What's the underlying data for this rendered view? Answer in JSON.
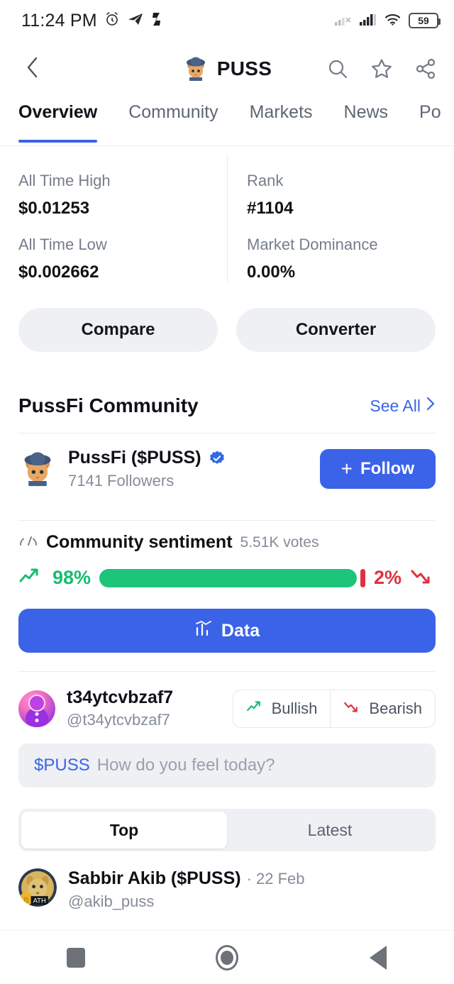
{
  "statusbar": {
    "time": "11:24 PM",
    "battery": "59",
    "icons": [
      "alarm-icon",
      "telegram-icon",
      "shazam-icon",
      "signal-off-icon",
      "signal-icon",
      "wifi-icon",
      "battery-icon"
    ]
  },
  "header": {
    "back_icon": "chevron-left-icon",
    "title": "PUSS",
    "logo": "puss-cat-logo",
    "actions": [
      "search-icon",
      "star-icon",
      "share-icon"
    ]
  },
  "tabs": [
    {
      "label": "Overview",
      "active": true
    },
    {
      "label": "Community",
      "active": false
    },
    {
      "label": "Markets",
      "active": false
    },
    {
      "label": "News",
      "active": false
    },
    {
      "label": "Po",
      "active": false
    }
  ],
  "stats": [
    {
      "label": "All Time High",
      "value": "$0.01253"
    },
    {
      "label": "Rank",
      "value": "#1104"
    },
    {
      "label": "All Time Low",
      "value": "$0.002662"
    },
    {
      "label": "Market Dominance",
      "value": "0.00%"
    }
  ],
  "actions": {
    "compare": "Compare",
    "converter": "Converter"
  },
  "community": {
    "section_title": "PussFi Community",
    "see_all": "See All",
    "profile": {
      "name": "PussFi ($PUSS)",
      "followers": "7141 Followers",
      "verified": true,
      "follow_label": "Follow",
      "plus": "+"
    },
    "sentiment": {
      "title": "Community sentiment",
      "votes": "5.51K votes",
      "bullish_pct": "98%",
      "bearish_pct": "2%",
      "bullish_value": 98,
      "bearish_value": 2,
      "bullish_color": "#1ec47a",
      "bearish_color": "#e0303f"
    },
    "data_button": "Data"
  },
  "composer": {
    "user_name": "t34ytcvbzaf7",
    "user_handle": "@t34ytcvbzaf7",
    "bullish_label": "Bullish",
    "bearish_label": "Bearish",
    "ticker": "$PUSS",
    "placeholder": "How do you feel today?"
  },
  "feed_tabs": [
    {
      "label": "Top",
      "active": true
    },
    {
      "label": "Latest",
      "active": false
    }
  ],
  "posts": [
    {
      "name": "Sabbir Akib ($PUSS)",
      "date": "· 22 Feb",
      "handle": "@akib_puss"
    }
  ],
  "navbar": {
    "recents": "recents-square-icon",
    "home": "home-circle-icon",
    "back": "back-triangle-icon"
  },
  "colors": {
    "accent": "#3b63e8",
    "bullish": "#1ec47a",
    "bearish": "#e0303f",
    "muted": "#858c99"
  }
}
